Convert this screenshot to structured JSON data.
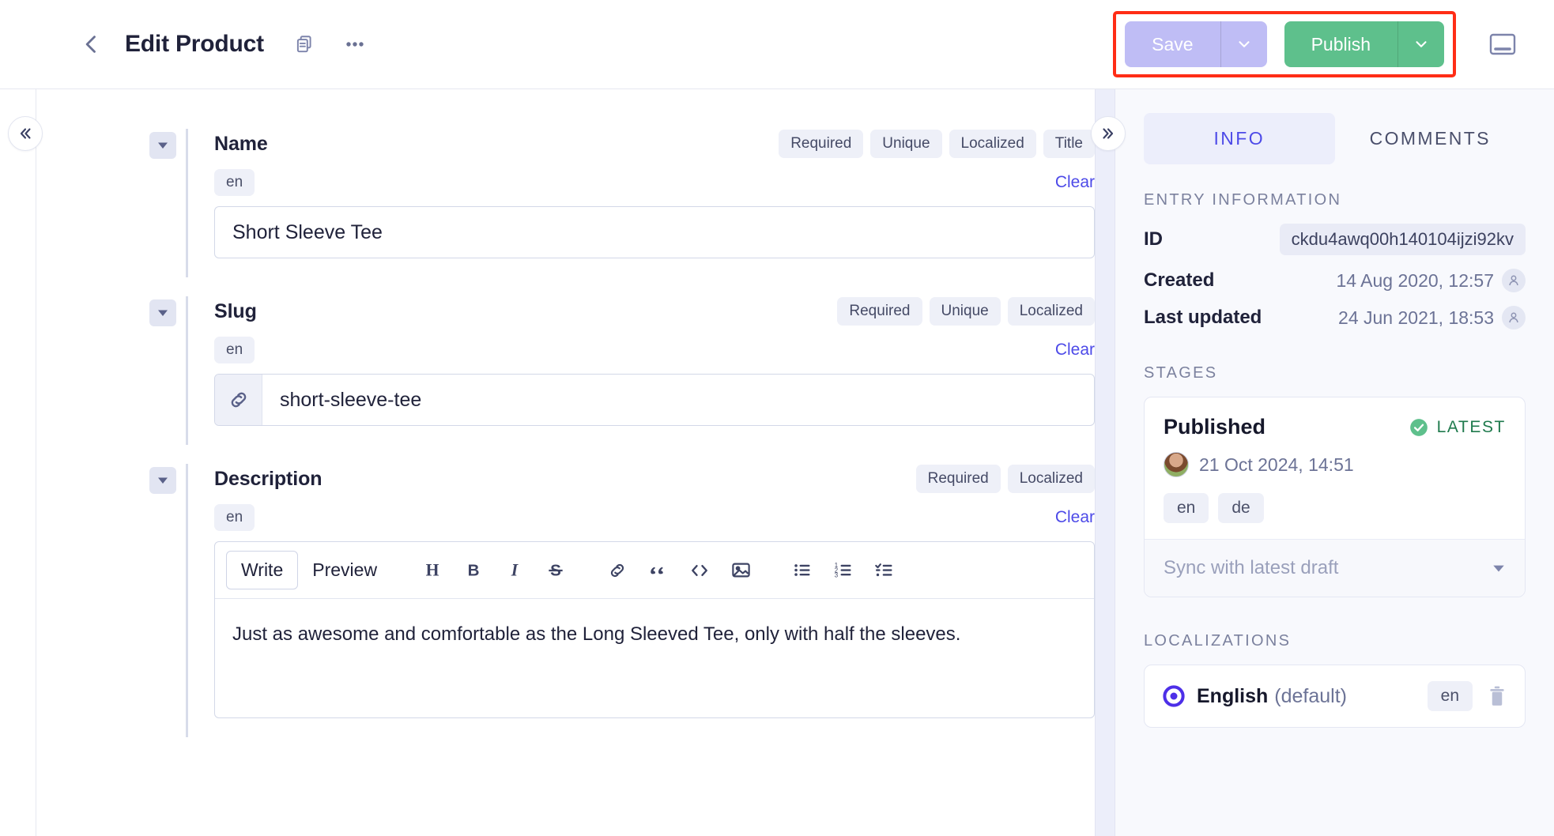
{
  "header": {
    "back_icon": "chevron-left-icon",
    "title": "Edit Product",
    "duplicate_icon": "duplicate-icon",
    "more_icon": "ellipsis-icon",
    "save_label": "Save",
    "publish_label": "Publish",
    "panel_toggle_icon": "panel-toggle-icon",
    "caret_icon": "chevron-down-icon"
  },
  "rail": {
    "collapse_icon": "chevrons-left-icon"
  },
  "gutter": {
    "expand_icon": "chevrons-right-icon"
  },
  "fields": [
    {
      "label": "Name",
      "tags": [
        "Required",
        "Unique",
        "Localized",
        "Title"
      ],
      "locale": "en",
      "clear": "Clear",
      "value": "Short Sleeve Tee",
      "placeholder": ""
    },
    {
      "label": "Slug",
      "tags": [
        "Required",
        "Unique",
        "Localized"
      ],
      "locale": "en",
      "clear": "Clear",
      "value": "short-sleeve-tee",
      "addon_icon": "link-icon",
      "placeholder": ""
    },
    {
      "label": "Description",
      "tags": [
        "Required",
        "Localized"
      ],
      "locale": "en",
      "clear": "Clear",
      "value": "Just as awesome and comfortable as the Long Sleeved Tee, only with half the sleeves."
    }
  ],
  "editor": {
    "tab_write": "Write",
    "tab_preview": "Preview",
    "tools": [
      "heading-icon",
      "bold-icon",
      "italic-icon",
      "strikethrough-icon",
      "link-icon",
      "quote-icon",
      "code-icon",
      "image-icon",
      "bulleted-list-icon",
      "numbered-list-icon",
      "checklist-icon"
    ]
  },
  "sidebar": {
    "tabs": [
      {
        "label": "INFO",
        "active": true
      },
      {
        "label": "COMMENTS",
        "active": false
      }
    ],
    "entry_information": {
      "heading": "ENTRY INFORMATION",
      "rows": [
        {
          "key": "ID",
          "value": "ckdu4awq00h140104ijzi92kv",
          "type": "pill"
        },
        {
          "key": "Created",
          "value": "14 Aug 2020, 12:57",
          "type": "date",
          "user_icon": "user-icon"
        },
        {
          "key": "Last updated",
          "value": "24 Jun 2021, 18:53",
          "type": "date",
          "user_icon": "user-icon"
        }
      ]
    },
    "stages": {
      "heading": "STAGES",
      "stage_name": "Published",
      "latest_badge": "LATEST",
      "latest_icon": "check-circle-icon",
      "date": "21 Oct 2024, 14:51",
      "avatar": "user-avatar",
      "locales": [
        "en",
        "de"
      ],
      "sync_label": "Sync with latest draft",
      "sync_caret": "triangle-down-icon"
    },
    "localizations": {
      "heading": "LOCALIZATIONS",
      "items": [
        {
          "radio_icon": "radio-selected-icon",
          "name": "English",
          "default_note": "(default)",
          "code": "en",
          "delete_icon": "trash-icon"
        }
      ]
    }
  },
  "colors": {
    "accent": "#4d4ae8",
    "publish_green": "#5ec08c",
    "save_disabled": "#bfbdf5",
    "highlight": "#ff2d16",
    "sidebar_bg": "#f8f9fd"
  }
}
